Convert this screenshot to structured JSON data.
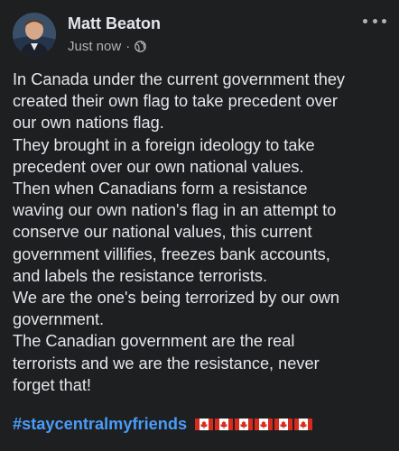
{
  "post": {
    "author_name": "Matt Beaton",
    "timestamp": "Just now",
    "separator": "·",
    "privacy_icon": "globe-icon",
    "menu_icon": "more-options-icon",
    "body_lines": [
      "In Canada under the current government they",
      "created their own flag to take precedent over",
      "our own nations flag.",
      "They brought in a foreign ideology to take",
      "precedent over our own national values.",
      "Then when Canadians form a resistance",
      "waving our own nation's flag in an attempt to",
      "conserve our national values, this current",
      "government villifies, freezes bank accounts,",
      "and labels the resistance terrorists.",
      "We are the one's being terrorized by our own",
      "government.",
      "The Canadian government are the real",
      "terrorists and we are the resistance, never",
      "forget that!"
    ],
    "hashtag": "#staycentralmyfriends",
    "flag_emoji": "canada-flag-emoji",
    "flag_count": 6
  },
  "colors": {
    "background": "#1e1f21",
    "text": "#e4e6eb",
    "secondary_text": "#b0b3b8",
    "hashtag": "#4a9cf8",
    "flag_red": "#d52b1e"
  }
}
